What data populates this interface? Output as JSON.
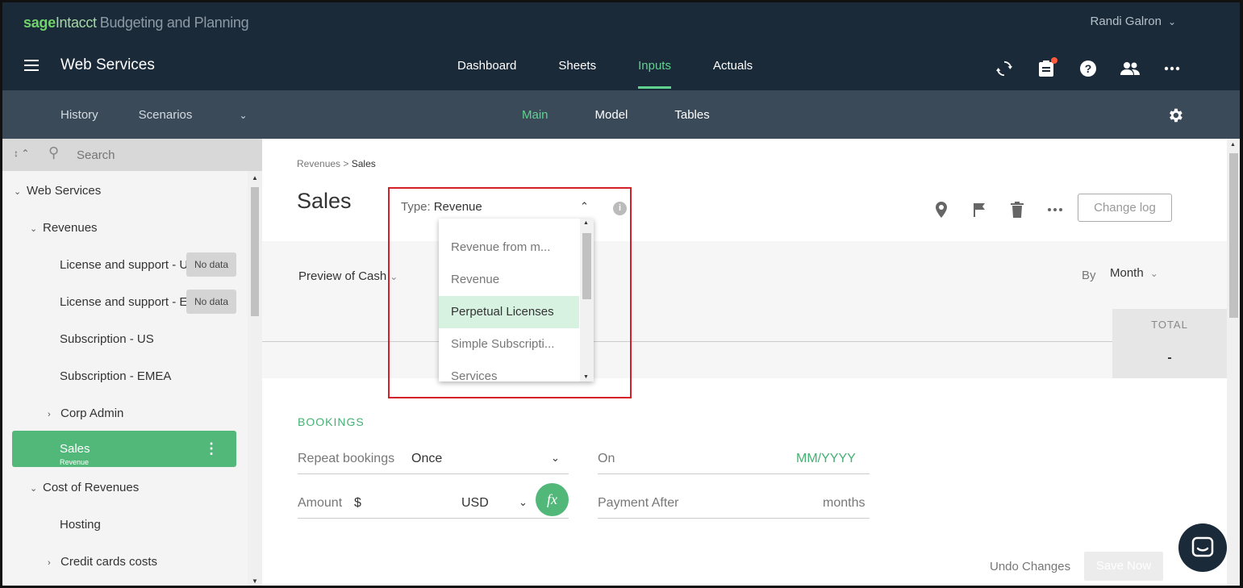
{
  "header": {
    "brand_sage": "sage",
    "brand_intacct": "Intacct",
    "brand_product": "Budgeting and Planning",
    "user_name": "Randi Galron",
    "app_title": "Web Services",
    "nav": [
      {
        "label": "Dashboard"
      },
      {
        "label": "Sheets"
      },
      {
        "label": "Inputs"
      },
      {
        "label": "Actuals"
      }
    ],
    "icons": [
      "refresh-icon",
      "clipboard-icon",
      "help-icon",
      "users-icon",
      "more-icon"
    ]
  },
  "subnav": {
    "history": "History",
    "scenarios": "Scenarios",
    "tabs": [
      {
        "label": "Main"
      },
      {
        "label": "Model"
      },
      {
        "label": "Tables"
      }
    ]
  },
  "sidebar": {
    "search_placeholder": "Search",
    "items": [
      {
        "label": "Web Services"
      },
      {
        "label": "Revenues"
      },
      {
        "label": "License and support - U",
        "badge": "No data"
      },
      {
        "label": "License and support - E",
        "badge": "No data"
      },
      {
        "label": "Subscription - US"
      },
      {
        "label": "Subscription - EMEA"
      },
      {
        "label": "Corp Admin"
      },
      {
        "label": "Sales",
        "sub": "Revenue"
      },
      {
        "label": "Cost of Revenues"
      },
      {
        "label": "Hosting"
      },
      {
        "label": "Credit cards costs"
      }
    ]
  },
  "content": {
    "breadcrumb_parent": "Revenues",
    "breadcrumb_sep": ">",
    "breadcrumb_current": "Sales",
    "title": "Sales",
    "type_label": "Type:",
    "type_value": "Revenue",
    "type_options": [
      {
        "label": "Revenue from m..."
      },
      {
        "label": "Revenue"
      },
      {
        "label": "Perpetual Licenses"
      },
      {
        "label": "Simple Subscripti..."
      },
      {
        "label": "Services"
      }
    ],
    "change_log": "Change log",
    "preview_label": "Preview of Cash",
    "by_label": "By",
    "by_value": "Month",
    "total_header": "TOTAL",
    "total_value": "-",
    "section_title": "BOOKINGS",
    "repeat_label": "Repeat bookings",
    "repeat_value": "Once",
    "on_label": "On",
    "on_placeholder": "MM/YYYY",
    "amount_label": "Amount",
    "amount_symbol": "$",
    "currency": "USD",
    "fx_label": "fx",
    "payment_label": "Payment After",
    "payment_unit": "months",
    "undo": "Undo Changes",
    "save": "Save Now"
  },
  "colors": {
    "topbar": "#1a2a39",
    "subnav": "#3b4a59",
    "accent": "#52b87a",
    "highlight": "#d7f2e1",
    "red_outline": "#d42027"
  }
}
